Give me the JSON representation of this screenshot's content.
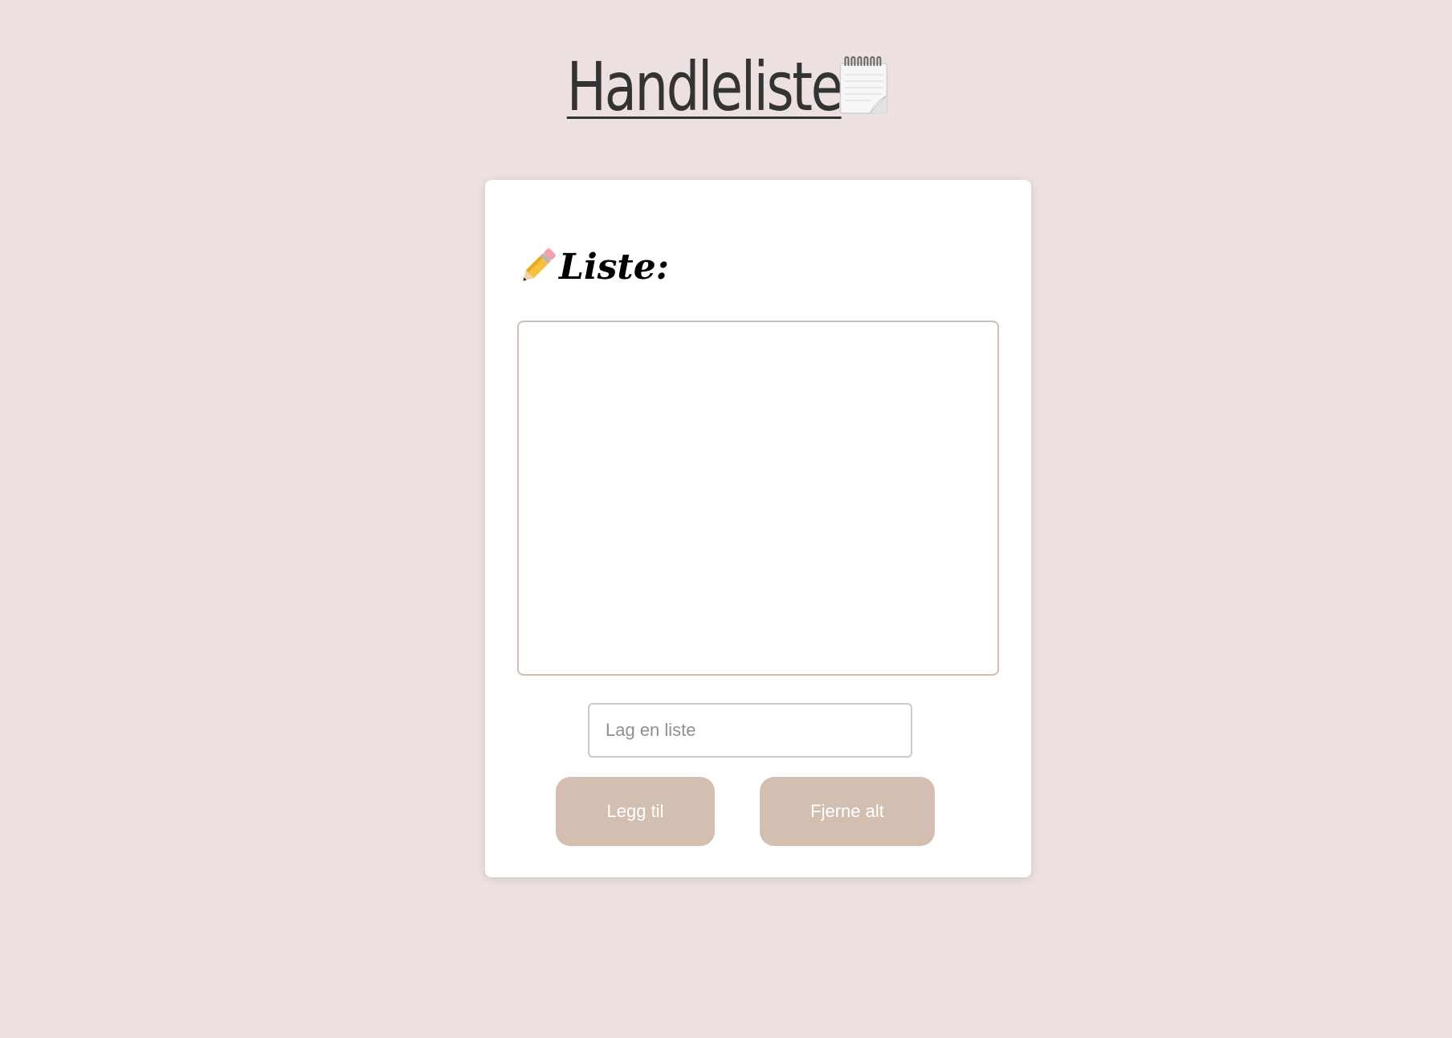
{
  "header": {
    "title": "Handleliste",
    "icon": "notepad-icon"
  },
  "card": {
    "heading_icon": "pencil-icon",
    "heading": "Liste:",
    "list_items": [],
    "input": {
      "value": "",
      "placeholder": "Lag en liste"
    },
    "add_label": "Legg til",
    "clear_label": "Fjerne alt"
  },
  "colors": {
    "background": "#ece0e0",
    "card": "#ffffff",
    "button": "#d3beb2",
    "title_text": "#333333",
    "list_border": "#d4bdb0"
  }
}
